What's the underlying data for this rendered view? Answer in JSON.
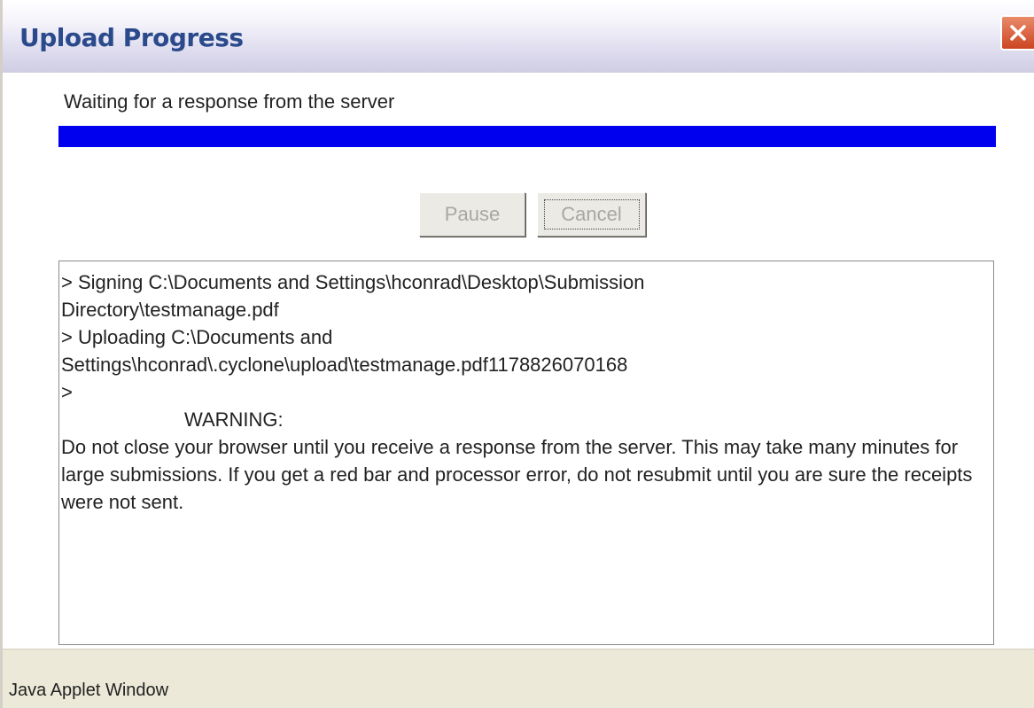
{
  "window": {
    "title": "Upload Progress",
    "close_icon": "close-x-icon"
  },
  "status": {
    "message": "Waiting for a response from the server",
    "progress_percent": 100,
    "progress_color": "#0000ee"
  },
  "buttons": {
    "pause_label": "Pause",
    "cancel_label": "Cancel"
  },
  "log": {
    "lines": [
      "> Signing C:\\Documents and Settings\\hconrad\\Desktop\\Submission",
      "Directory\\testmanage.pdf",
      "> Uploading C:\\Documents and",
      "Settings\\hconrad\\.cyclone\\upload\\testmanage.pdf1178826070168",
      ">"
    ],
    "warning_title": "WARNING:",
    "warning_body": "Do not close your browser until you receive a response from the server.  This may take many minutes for large submissions.  If you get a red bar and processor error, do not resubmit until you are sure the receipts were not sent."
  },
  "footer": {
    "text": "Java Applet Window"
  }
}
